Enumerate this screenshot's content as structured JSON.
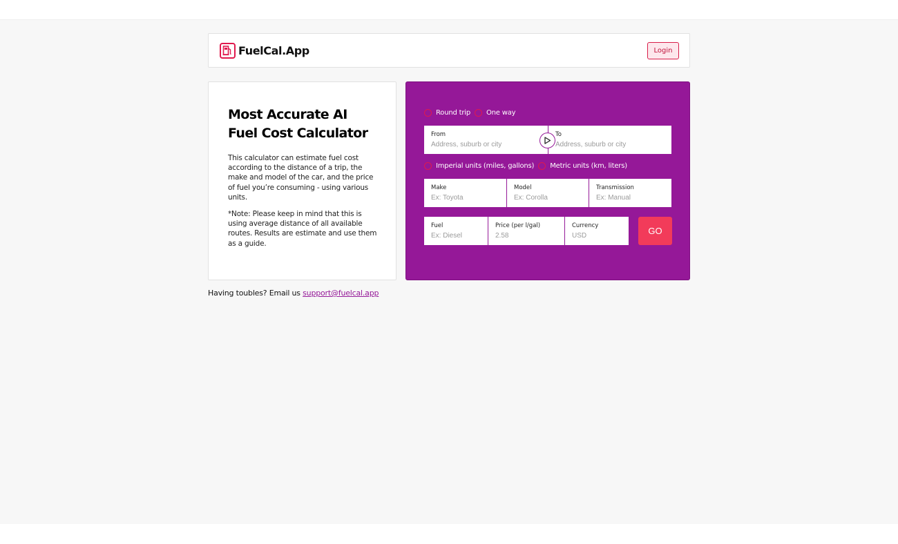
{
  "header": {
    "brand": "FuelCal.App",
    "login_label": "Login"
  },
  "info": {
    "title_line1": "Most Accurate AI",
    "title_line2": "Fuel Cost Calculator",
    "description": "This calculator can estimate fuel cost according to the distance of a trip, the make and model of the car, and the price of fuel you’re consuming - using various units.",
    "note": "*Note: Please keep in mind that this is using average distance of all available routes. Results are estimate and use them as a guide."
  },
  "calculator": {
    "trip_options": [
      "Round trip",
      "One way"
    ],
    "from_label": "From",
    "from_placeholder": "Address, suburb or city",
    "to_label": "To",
    "to_placeholder": "Address, suburb or city",
    "unit_options": [
      "Imperial units (miles, gallons)",
      "Metric units (km, liters)"
    ],
    "make_label": "Make",
    "make_placeholder": "Ex: Toyota",
    "model_label": "Model",
    "model_placeholder": "Ex: Corolla",
    "transmission_label": "Transmission",
    "transmission_placeholder": "Ex: Manual",
    "fuel_label": "Fuel",
    "fuel_placeholder": "Ex: Diesel",
    "price_label": "Price (per l/gal)",
    "price_placeholder": "2.58",
    "currency_label": "Currency",
    "currency_placeholder": "USD",
    "go_label": "GO"
  },
  "footer": {
    "text": "Having toubles? Email us",
    "email": "support@fuelcal.app"
  },
  "colors": {
    "accent": "#e0194d",
    "panel": "#951898",
    "go": "#f23b5a"
  },
  "icons": {
    "logo": "fuel-pump-icon",
    "swap": "play-arrow-icon"
  }
}
